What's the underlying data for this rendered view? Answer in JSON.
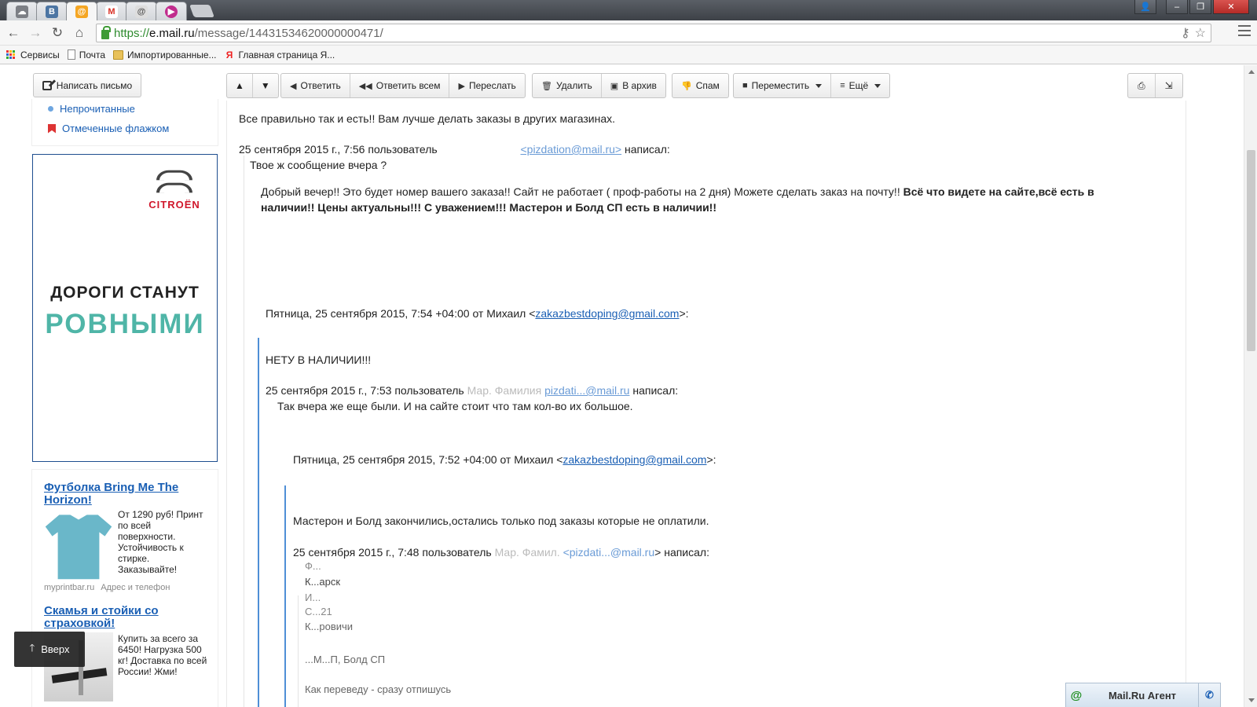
{
  "browser": {
    "tabs": [
      {
        "icon": "app-icon",
        "color": "#7c7f85",
        "glyph": "☁"
      },
      {
        "icon": "vk-icon",
        "color": "#4c75a3",
        "glyph": "B"
      },
      {
        "icon": "mailru-icon",
        "color": "#f5a623",
        "glyph": "@"
      },
      {
        "icon": "gmail-icon",
        "color": "#d93025",
        "glyph": "M"
      },
      {
        "icon": "at-icon",
        "color": "#666666",
        "glyph": "@"
      },
      {
        "icon": "video-icon",
        "color": "#c12c8d",
        "glyph": "▶"
      }
    ],
    "url": {
      "scheme": "https://",
      "host": "e.mail.ru",
      "path": "/message/14431534620000000471/"
    },
    "bookmarks": [
      "Сервисы",
      "Почта",
      "Импортированные...",
      "Главная страница Я..."
    ]
  },
  "sidebar": {
    "compose_label": "Написать письмо",
    "folders": [
      "Непрочитанные",
      "Отмеченные флажком"
    ],
    "citroen_ad": {
      "brand": "CITROËN",
      "line1": "ДОРОГИ СТАНУТ",
      "line2": "РОВНЫМИ"
    },
    "ads": [
      {
        "title": "Футболка Bring Me The Horizon!",
        "desc": "От 1290 руб! Принт по всей поверхности. Устойчивость к стирке. Заказывайте!",
        "source": "myprintbar.ru",
        "extra": "Адрес и телефон"
      },
      {
        "title": "Скамья и стойки со страховкой!",
        "desc": "Купить за всего за 6450! Нагрузка 500 кг! Доставка по всей России! Жми!"
      }
    ],
    "up_label": "Вверх"
  },
  "message_toolbar": {
    "reply": "Ответить",
    "reply_all": "Ответить всем",
    "forward": "Переслать",
    "delete": "Удалить",
    "archive": "В архив",
    "spam": "Спам",
    "move": "Переместить",
    "more": "Ещё"
  },
  "message": {
    "line1": "Все правильно так и есть!! Вам лучше делать заказы в других магазинах.",
    "quote1_head": "25 сентября 2015 г., 7:56 пользователь",
    "quote1_email": "<pizdation@mail.ru>",
    "quote1_tail": "написал:",
    "quote1_text": "Твое ж сообщение вчера ?",
    "reply_a_plain": "Добрый вечер!! Это будет номер вашего заказа!! Сайт не работает ( проф-работы на 2 дня) Можете сделать заказ на почту!!",
    "reply_a_bold1": "Всё что видете на сайте,всё есть в",
    "reply_a_bold2": "наличии!! Цены актуальны!!! С уважением!!! Мастерон и Болд СП есть в наличии!!",
    "hdr2_prefix": "Пятница, 25 сентября 2015, 7:54 +04:00 от Михаил <",
    "hdr2_email": "zakazbestdoping@gmail.com",
    "hdr2_suffix": ">:",
    "not_available": "НЕТУ В НАЛИЧИИ!!!",
    "quote2_head": "25 сентября 2015 г., 7:53 пользователь",
    "quote2_name": "Мар. Фамилия",
    "quote2_email": "pizdati...@mail.ru",
    "quote2_tail": "написал:",
    "quote2_text": "Так вчера же еще были. И на сайте стоит что там кол-во их большое.",
    "hdr3_prefix": "Пятница, 25 сентября 2015, 7:52 +04:00 от Михаил <",
    "hdr3_email": "zakazbestdoping@gmail.com",
    "hdr3_suffix": ">:",
    "over_text": "Мастерон и Болд закончились,остались только под заказы которые не оплатили.",
    "quote3_head": "25 сентября 2015 г., 7:48 пользователь",
    "quote3_name": "Мар. Фамил.",
    "quote3_email": "<pizdati...@mail.ru",
    "quote3_tail": "> написал:",
    "order_lines": [
      "Ф...",
      "К...арск",
      "И...",
      "С...21",
      "К...ровичи"
    ],
    "order_item": "...М...П, Болд СП",
    "order_last": "Как переведу - сразу отпишусь"
  },
  "agent": {
    "title": "Mail.Ru Агент"
  }
}
